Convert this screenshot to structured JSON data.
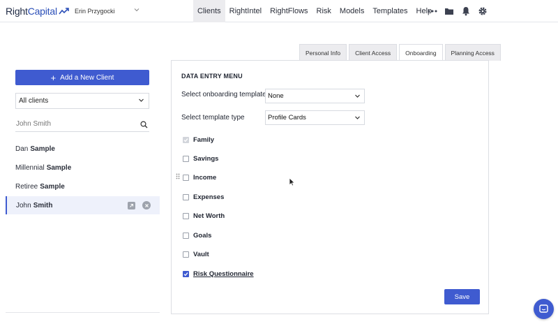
{
  "brand": {
    "name_part1": "Right",
    "name_part2": "Capital",
    "accent": "#3f5bd0"
  },
  "user": {
    "name": "Erin Przygocki"
  },
  "nav": {
    "items": [
      {
        "label": "Clients",
        "active": true
      },
      {
        "label": "RightIntel",
        "active": false
      },
      {
        "label": "RightFlows",
        "active": false
      },
      {
        "label": "Risk",
        "active": false
      },
      {
        "label": "Models",
        "active": false
      },
      {
        "label": "Templates",
        "active": false
      },
      {
        "label": "Help",
        "active": false
      }
    ],
    "icons": [
      "more-icon",
      "folder-icon",
      "bell-icon",
      "gear-icon"
    ]
  },
  "sidebar": {
    "add_button": "Add a New Client",
    "filter_value": "All clients",
    "search_placeholder": "John Smith",
    "clients": [
      {
        "first": "Dan",
        "last": "Sample",
        "active": false
      },
      {
        "first": "Millennial",
        "last": "Sample",
        "active": false
      },
      {
        "first": "Retiree",
        "last": "Sample",
        "active": false
      },
      {
        "first": "John",
        "last": "Smith",
        "active": true
      }
    ]
  },
  "tabs": [
    {
      "label": "Personal Info",
      "active": false
    },
    {
      "label": "Client Access",
      "active": false
    },
    {
      "label": "Onboarding",
      "active": true
    },
    {
      "label": "Planning Access",
      "active": false
    }
  ],
  "panel": {
    "title": "DATA ENTRY MENU",
    "template_label": "Select onboarding template",
    "template_value": "None",
    "type_label": "Select template type",
    "type_value": "Profile Cards",
    "items": [
      {
        "label": "Family",
        "checked": true,
        "disabled": true
      },
      {
        "label": "Savings",
        "checked": false,
        "disabled": false
      },
      {
        "label": "Income",
        "checked": false,
        "disabled": false
      },
      {
        "label": "Expenses",
        "checked": false,
        "disabled": false
      },
      {
        "label": "Net Worth",
        "checked": false,
        "disabled": false
      },
      {
        "label": "Goals",
        "checked": false,
        "disabled": false
      },
      {
        "label": "Vault",
        "checked": false,
        "disabled": false
      },
      {
        "label": "Risk Questionnaire",
        "checked": true,
        "disabled": false
      }
    ],
    "save_label": "Save"
  }
}
